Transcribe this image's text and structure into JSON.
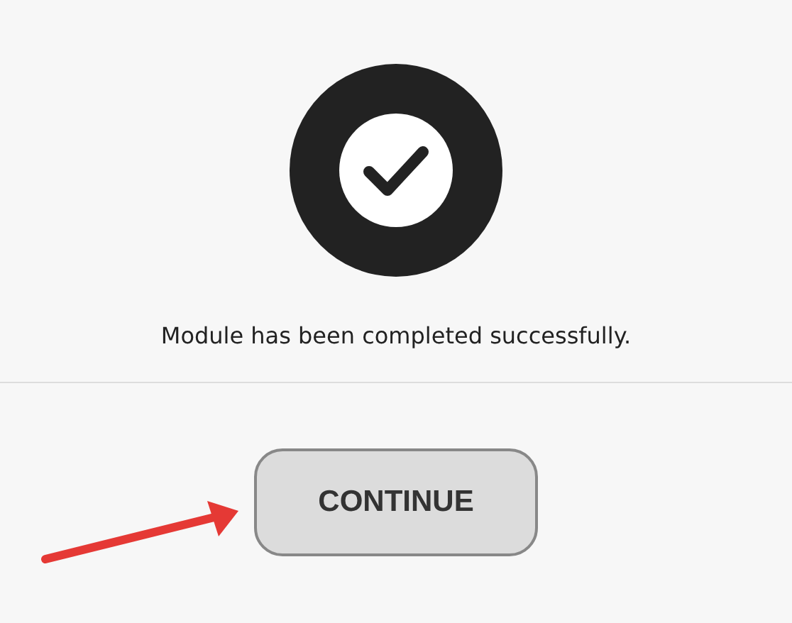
{
  "message": "Module has been completed successfully.",
  "button": {
    "label": "CONTINUE"
  }
}
